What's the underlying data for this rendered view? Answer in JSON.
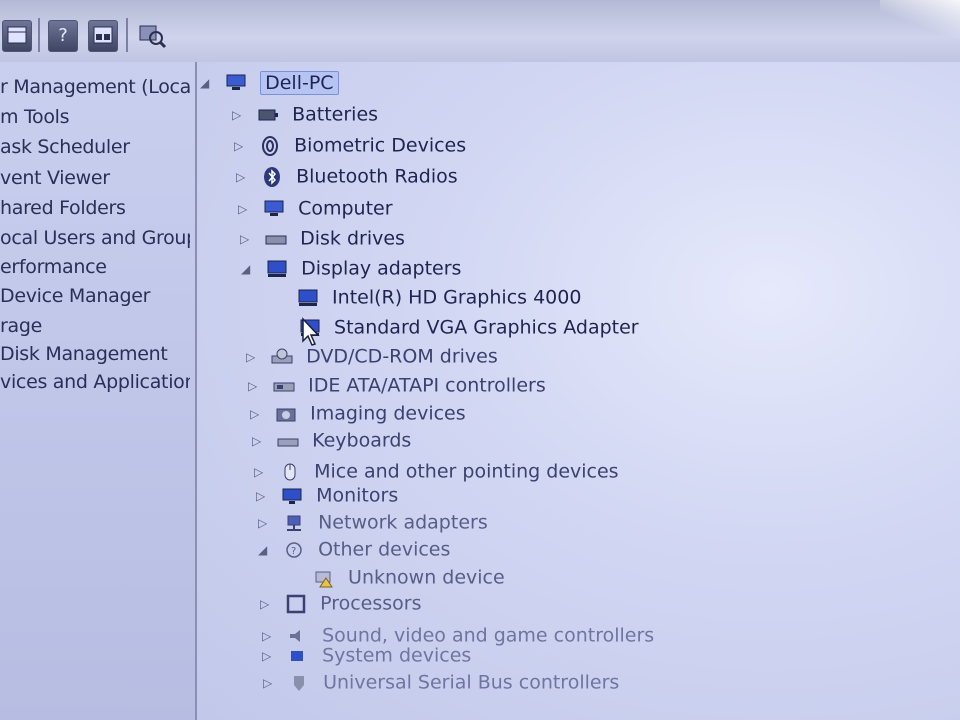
{
  "toolbar": {
    "buttons": [
      "properties-icon",
      "help-icon",
      "view-icon",
      "scan-hardware-icon"
    ],
    "help_label": "?"
  },
  "left_pane": {
    "items": [
      "r Management (Local",
      "m Tools",
      "ask Scheduler",
      "vent Viewer",
      "hared Folders",
      "ocal Users and Groups",
      "erformance",
      "Device Manager",
      "rage",
      "Disk Management",
      "vices and Applications"
    ]
  },
  "tree": {
    "root": "Dell-PC",
    "categories": [
      {
        "label": "Batteries",
        "icon": "battery-icon"
      },
      {
        "label": "Biometric Devices",
        "icon": "fingerprint-icon"
      },
      {
        "label": "Bluetooth Radios",
        "icon": "bluetooth-icon"
      },
      {
        "label": "Computer",
        "icon": "computer-icon"
      },
      {
        "label": "Disk drives",
        "icon": "disk-drive-icon"
      },
      {
        "label": "Display adapters",
        "icon": "display-adapter-icon",
        "children": [
          {
            "label": "Intel(R) HD Graphics 4000",
            "icon": "display-adapter-icon"
          },
          {
            "label": "Standard VGA Graphics Adapter",
            "icon": "display-adapter-icon"
          }
        ]
      },
      {
        "label": "DVD/CD-ROM drives",
        "icon": "dvd-drive-icon"
      },
      {
        "label": "IDE ATA/ATAPI controllers",
        "icon": "ide-controller-icon"
      },
      {
        "label": "Imaging devices",
        "icon": "camera-icon"
      },
      {
        "label": "Keyboards",
        "icon": "keyboard-icon"
      },
      {
        "label": "Mice and other pointing devices",
        "icon": "mouse-icon"
      },
      {
        "label": "Monitors",
        "icon": "monitor-icon"
      },
      {
        "label": "Network adapters",
        "icon": "network-adapter-icon"
      },
      {
        "label": "Other devices",
        "icon": "unknown-device-icon",
        "children": [
          {
            "label": "Unknown device",
            "icon": "warning-device-icon"
          }
        ]
      },
      {
        "label": "Processors",
        "icon": "processor-icon"
      },
      {
        "label": "Sound, video and game controllers",
        "icon": "sound-icon"
      },
      {
        "label": "System devices",
        "icon": "system-device-icon"
      },
      {
        "label": "Universal Serial Bus controllers",
        "icon": "usb-icon"
      }
    ]
  },
  "colors": {
    "selection": "#b6c4f4",
    "text": "#1f2450",
    "accent": "#2c4fc9"
  }
}
